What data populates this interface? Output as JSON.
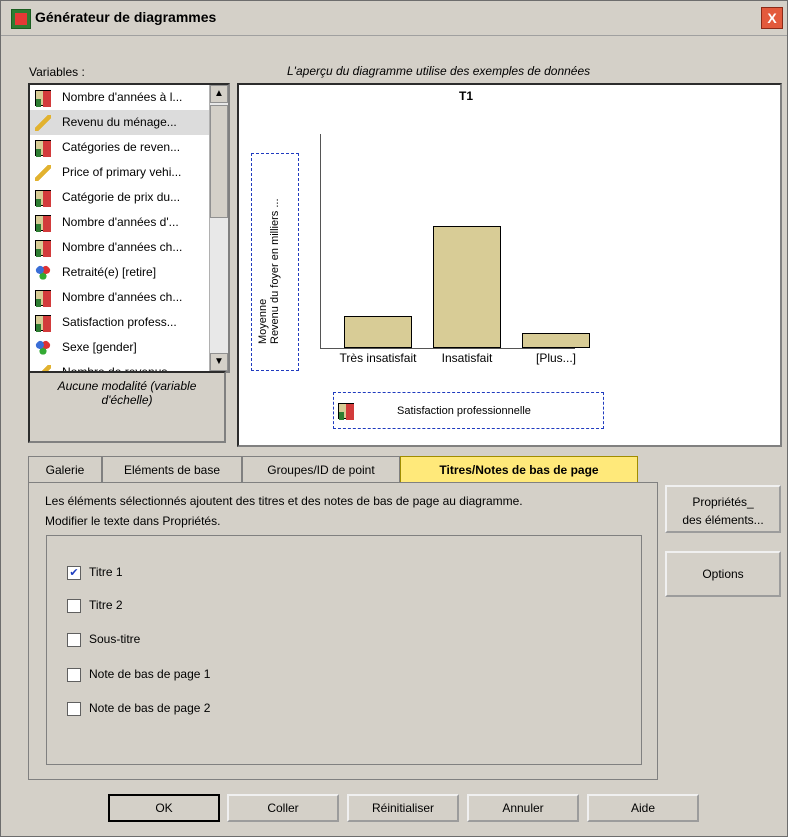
{
  "window": {
    "title": "Générateur de diagrammes",
    "close": "X"
  },
  "variables": {
    "label": "Variables :",
    "items": [
      {
        "label": "Nombre d'années à l...",
        "icon": "bar-chart-icon"
      },
      {
        "label": "Revenu du ménage...",
        "icon": "ruler-icon",
        "selected": true
      },
      {
        "label": "Catégories de reven...",
        "icon": "bar-chart-icon"
      },
      {
        "label": "Price of primary vehi...",
        "icon": "ruler-icon"
      },
      {
        "label": "Catégorie de prix du...",
        "icon": "bar-chart-icon"
      },
      {
        "label": "Nombre d'années d'...",
        "icon": "bar-chart-icon"
      },
      {
        "label": "Nombre d'années ch...",
        "icon": "bar-chart-icon"
      },
      {
        "label": "Retraité(e) [retire]",
        "icon": "nominal-icon"
      },
      {
        "label": "Nombre d'années ch...",
        "icon": "bar-chart-icon"
      },
      {
        "label": "Satisfaction profess...",
        "icon": "bar-chart-icon"
      },
      {
        "label": "Sexe [gender]",
        "icon": "nominal-icon"
      },
      {
        "label": "Nombre de revenus...",
        "icon": "ruler-icon"
      }
    ],
    "modality_line1": "Aucune modalité (variable",
    "modality_line2": "d'échelle)"
  },
  "preview": {
    "caption": "L'aperçu du diagramme utilise des exemples de données",
    "chart_title": "T1",
    "y_label_1": "Moyenne",
    "y_label_2": "Revenu du foyer en milliers ...",
    "x_label": "Satisfaction professionnelle"
  },
  "chart_data": {
    "type": "bar",
    "categories": [
      "Très insatisfait",
      "Insatisfait",
      "[Plus...]"
    ],
    "values": [
      17,
      64,
      8
    ],
    "title": "T1"
  },
  "tabs": [
    {
      "label": "Galerie",
      "active": false
    },
    {
      "label": "Eléments de base",
      "active": false
    },
    {
      "label": "Groupes/ID de point",
      "active": false
    },
    {
      "label": "Titres/Notes de bas de page",
      "active": true
    }
  ],
  "panel": {
    "desc1": "Les éléments sélectionnés ajoutent des titres et des notes de bas de page au diagramme.",
    "desc2": "Modifier le texte dans Propriétés.",
    "options": [
      {
        "label": "Titre 1",
        "checked": true
      },
      {
        "label": "Titre 2",
        "checked": false
      },
      {
        "label": "Sous-titre",
        "checked": false
      },
      {
        "label": "Note de bas de page 1",
        "checked": false
      },
      {
        "label": "Note de bas de page 2",
        "checked": false
      }
    ]
  },
  "side_buttons": {
    "props_line1": "Propriétés_",
    "props_line2": "des éléments...",
    "options": "Options"
  },
  "buttons": {
    "ok": "OK",
    "paste": "Coller",
    "reset": "Réinitialiser",
    "cancel": "Annuler",
    "help": "Aide"
  }
}
